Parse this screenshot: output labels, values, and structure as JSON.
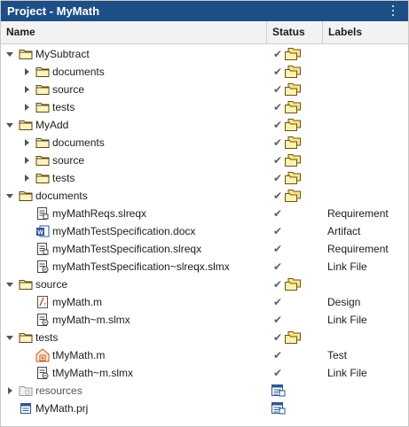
{
  "title": "Project - MyMath",
  "columns": {
    "name": "Name",
    "status": "Status",
    "labels": "Labels"
  },
  "rows": [
    {
      "name": "MySubtract",
      "kind": "folder",
      "depth": 0,
      "expanded": true,
      "status": "check-folder",
      "label": ""
    },
    {
      "name": "documents",
      "kind": "folder",
      "depth": 1,
      "expanded": false,
      "status": "check-folder",
      "label": ""
    },
    {
      "name": "source",
      "kind": "folder",
      "depth": 1,
      "expanded": false,
      "status": "check-folder",
      "label": ""
    },
    {
      "name": "tests",
      "kind": "folder",
      "depth": 1,
      "expanded": false,
      "status": "check-folder",
      "label": ""
    },
    {
      "name": "MyAdd",
      "kind": "folder",
      "depth": 0,
      "expanded": true,
      "status": "check-folder",
      "label": ""
    },
    {
      "name": "documents",
      "kind": "folder",
      "depth": 1,
      "expanded": false,
      "status": "check-folder",
      "label": ""
    },
    {
      "name": "source",
      "kind": "folder",
      "depth": 1,
      "expanded": false,
      "status": "check-folder",
      "label": ""
    },
    {
      "name": "tests",
      "kind": "folder",
      "depth": 1,
      "expanded": false,
      "status": "check-folder",
      "label": ""
    },
    {
      "name": "documents",
      "kind": "folder",
      "depth": 0,
      "expanded": true,
      "status": "check-folder",
      "label": ""
    },
    {
      "name": "myMathReqs.slreqx",
      "kind": "slreqx",
      "depth": 1,
      "status": "check",
      "label": "Requirement"
    },
    {
      "name": "myMathTestSpecification.docx",
      "kind": "docx",
      "depth": 1,
      "status": "check",
      "label": "Artifact"
    },
    {
      "name": "myMathTestSpecification.slreqx",
      "kind": "slreqx",
      "depth": 1,
      "status": "check",
      "label": "Requirement"
    },
    {
      "name": "myMathTestSpecification~slreqx.slmx",
      "kind": "slmx",
      "depth": 1,
      "status": "check",
      "label": "Link File"
    },
    {
      "name": "source",
      "kind": "folder",
      "depth": 0,
      "expanded": true,
      "status": "check-folder",
      "label": ""
    },
    {
      "name": "myMath.m",
      "kind": "mfile",
      "depth": 1,
      "status": "check",
      "label": "Design"
    },
    {
      "name": "myMath~m.slmx",
      "kind": "slmx",
      "depth": 1,
      "status": "check",
      "label": "Link File"
    },
    {
      "name": "tests",
      "kind": "folder",
      "depth": 0,
      "expanded": true,
      "status": "check-folder",
      "label": ""
    },
    {
      "name": "tMyMath.m",
      "kind": "testfile",
      "depth": 1,
      "status": "check",
      "label": "Test"
    },
    {
      "name": "tMyMath~m.slmx",
      "kind": "slmx",
      "depth": 1,
      "status": "check",
      "label": "Link File"
    },
    {
      "name": "resources",
      "kind": "resources",
      "depth": 0,
      "expanded": false,
      "status": "project",
      "label": ""
    },
    {
      "name": "MyMath.prj",
      "kind": "prj",
      "depth": 0,
      "status": "project",
      "label": ""
    }
  ]
}
